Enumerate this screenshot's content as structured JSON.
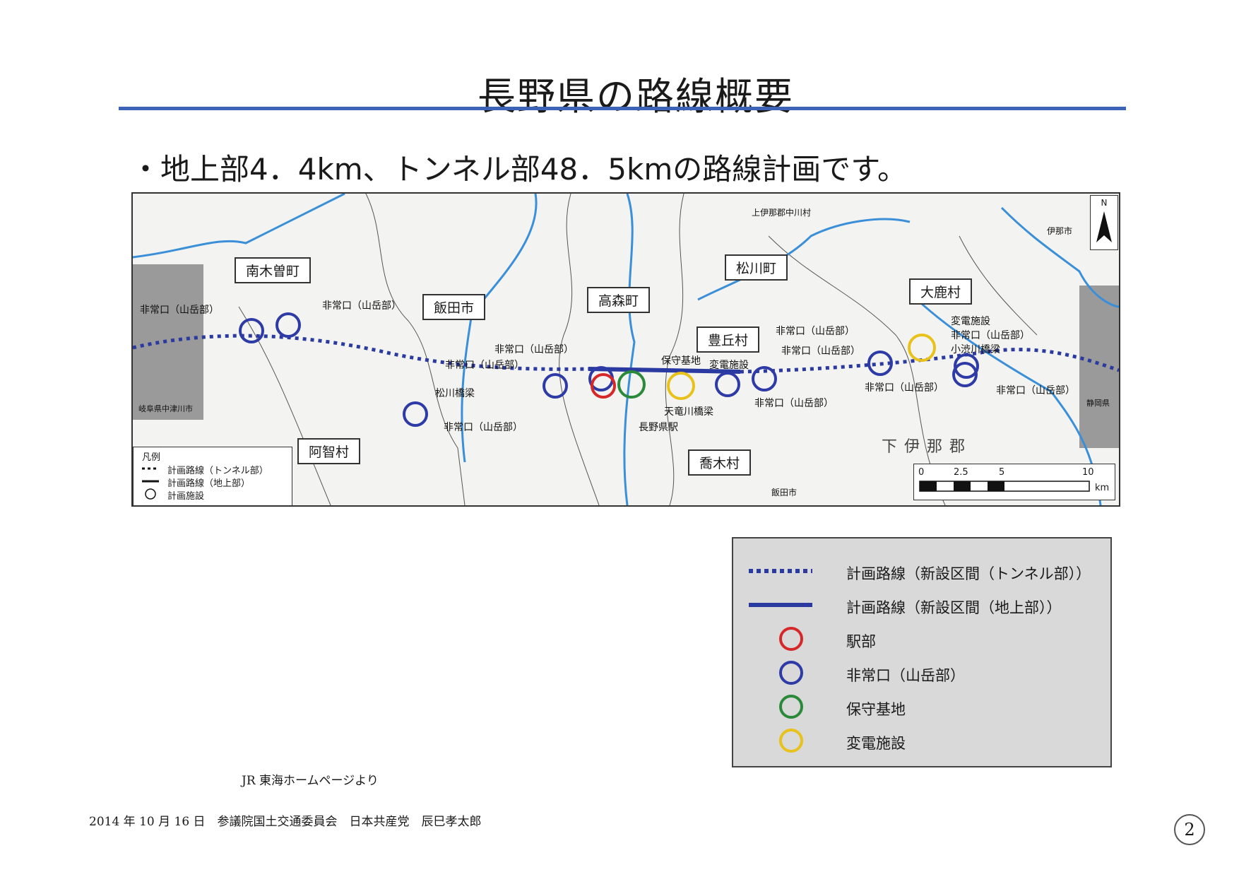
{
  "page": {
    "title": "長野県の路線概要",
    "subtitle": "・地上部4．4km、トンネル部48．5kmの路線計画です。",
    "source": "JR 東海ホームページより",
    "footer": "2014 年 10 月 16 日　参議院国土交通委員会　日本共産党　辰巳孝太郎",
    "page_number": "2"
  },
  "map": {
    "municipalities": [
      "南木曽町",
      "飯田市",
      "高森町",
      "松川町",
      "大鹿村",
      "豊丘村",
      "阿智村",
      "喬木村"
    ],
    "annotations": [
      "非常口（山岳部）",
      "非常口（山岳部）",
      "非常口（山岳部）",
      "非常口（山岳部）",
      "松川橋梁",
      "非常口（山岳部）",
      "保守基地",
      "変電施設",
      "天竜川橋梁",
      "長野県駅",
      "非常口（山岳部）",
      "非常口（山岳部）",
      "非常口（山岳部）",
      "変電施設",
      "非常口（山岳部）",
      "小渋川橋梁",
      "非常口（山岳部）",
      "非常口（山岳部）"
    ],
    "place_names": [
      "上伊那郡中川村",
      "伊那市",
      "岐阜県中津川市",
      "静岡県",
      "飯田市",
      "下伊那郡"
    ],
    "north_label": "N",
    "scale": {
      "ticks": [
        "0",
        "2.5",
        "5",
        "10"
      ],
      "unit": "km"
    },
    "legend_title": "凡例",
    "legend_items": [
      "計画路線（トンネル部）",
      "計画路線（地上部）",
      "計画施設"
    ]
  },
  "legend": {
    "items": [
      {
        "label": "計画路線（新設区間（トンネル部））",
        "symbol": "dotted-line",
        "color": "#2b3aa0"
      },
      {
        "label": "計画路線（新設区間（地上部））",
        "symbol": "solid-line",
        "color": "#2b3aa0"
      },
      {
        "label": "駅部",
        "symbol": "circle",
        "color": "#d62828"
      },
      {
        "label": "非常口（山岳部）",
        "symbol": "circle",
        "color": "#2e3ba6"
      },
      {
        "label": "保守基地",
        "symbol": "circle",
        "color": "#2a8a3a"
      },
      {
        "label": "変電施設",
        "symbol": "circle",
        "color": "#e8c21a"
      }
    ]
  },
  "colors": {
    "accent": "#3d63b8",
    "route": "#2b3aa0",
    "river": "#3a8fd8"
  }
}
